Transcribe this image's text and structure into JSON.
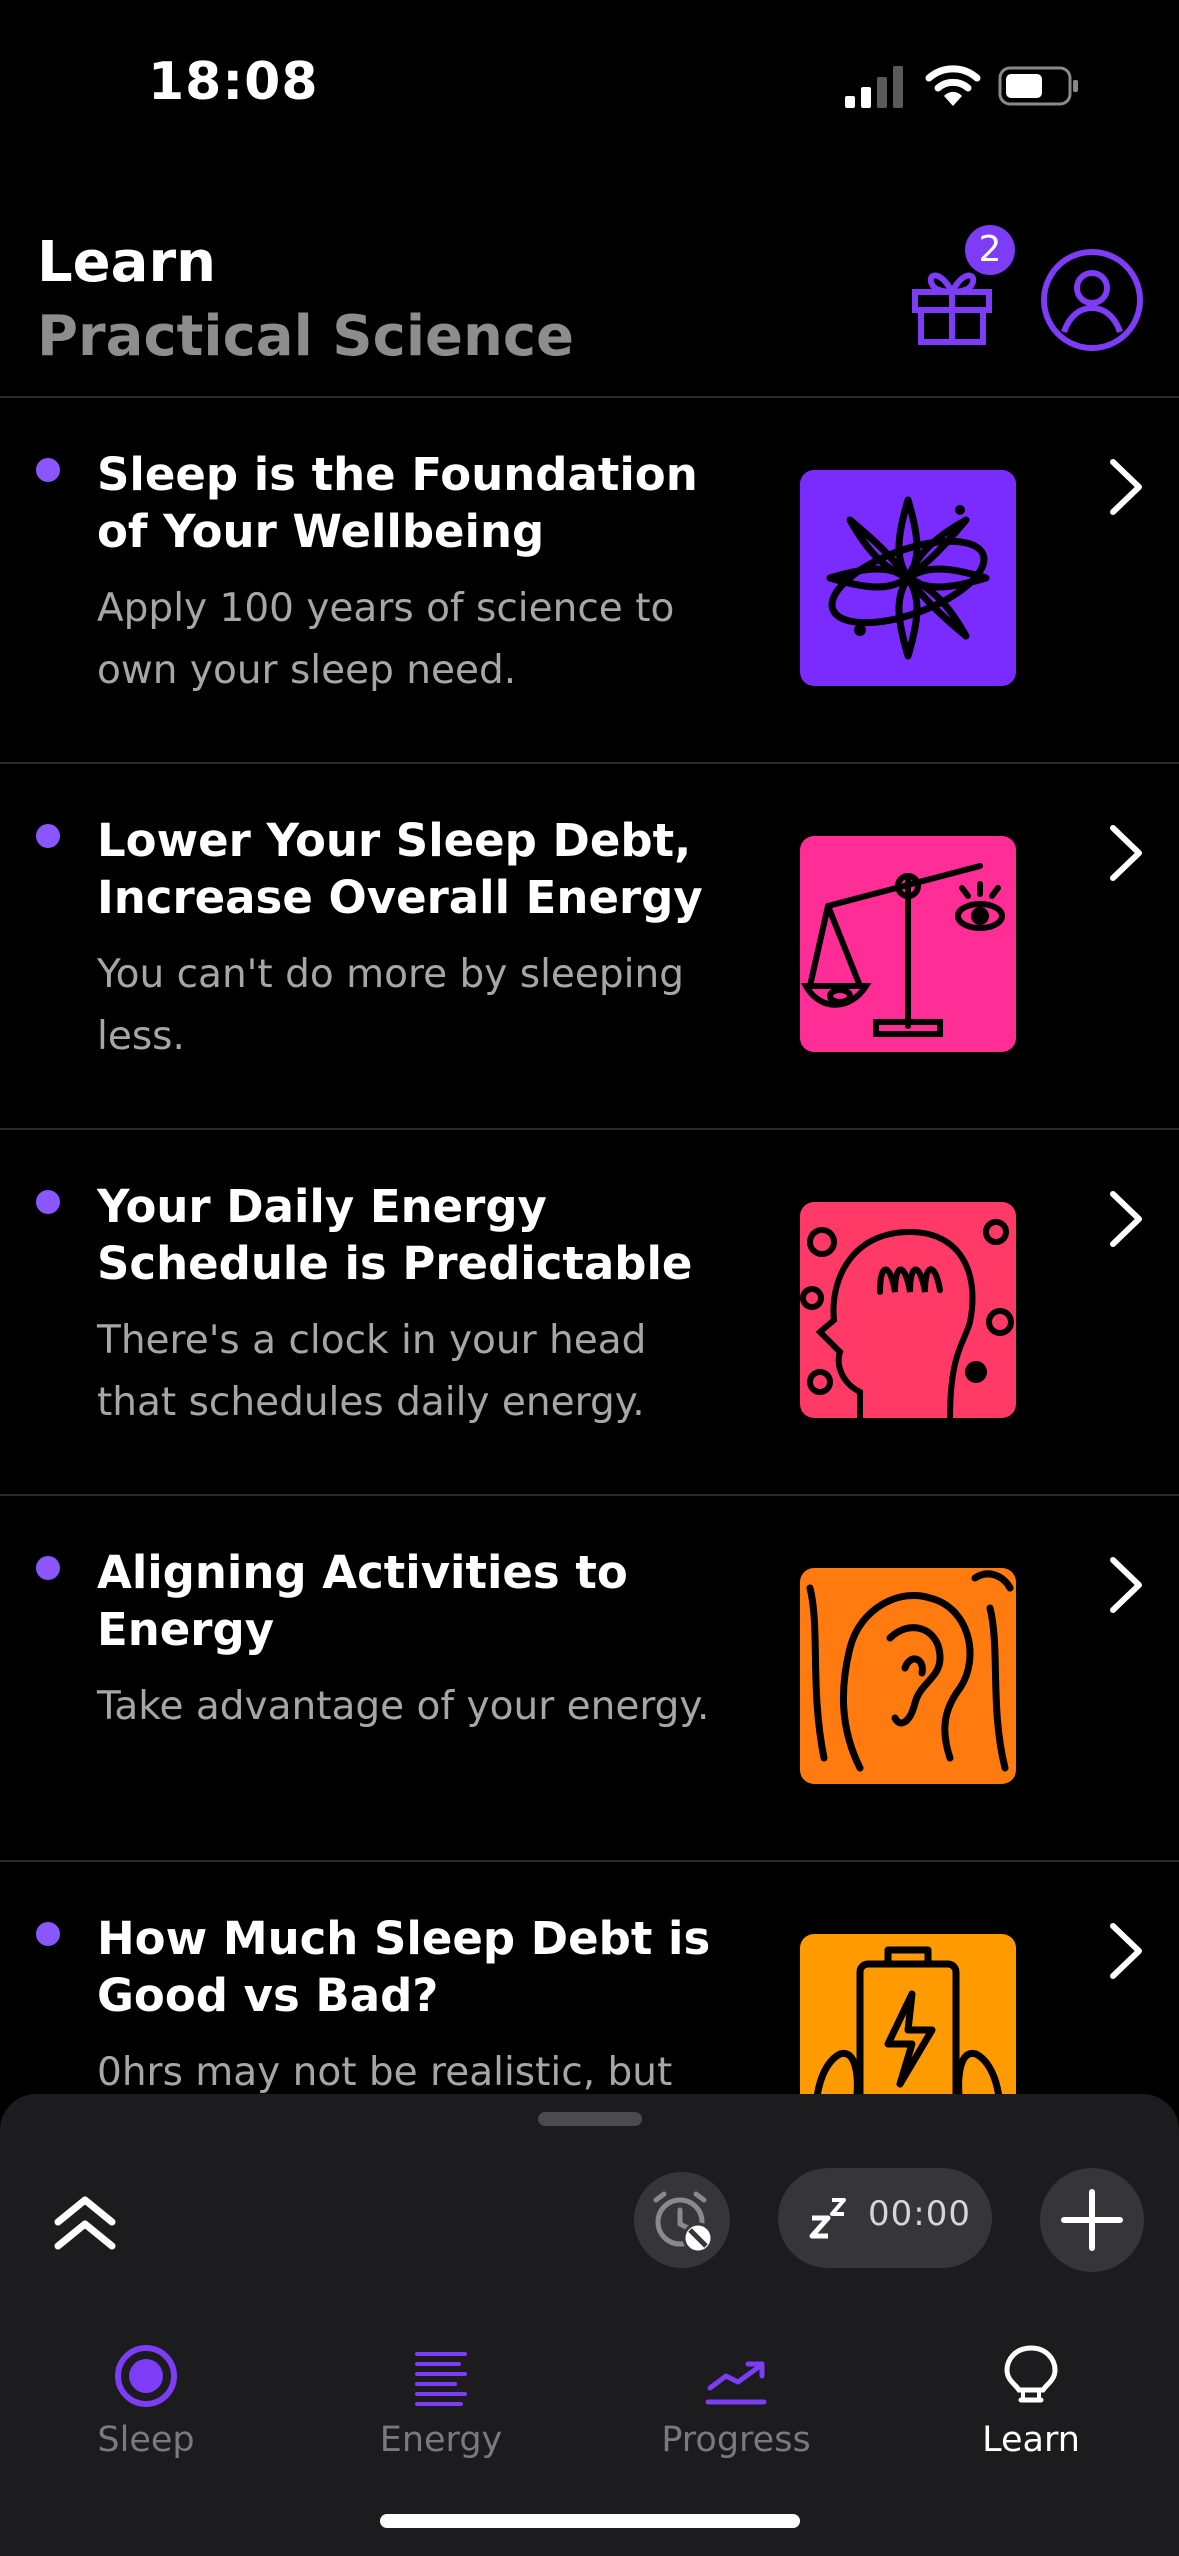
{
  "status": {
    "time": "18:08"
  },
  "header": {
    "title": "Learn",
    "subtitle": "Practical Science",
    "gift_badge": "2"
  },
  "articles": [
    {
      "title": "Sleep is the Foundation of Your Wellbeing",
      "desc": "Apply 100 years of science to own your sleep need.",
      "color": "#7a2cff",
      "icon": "sparkle-icon"
    },
    {
      "title": "Lower Your Sleep Debt, Increase Overall Energy",
      "desc": "You can't do more by sleeping less.",
      "color": "#ff2d95",
      "icon": "scale-icon"
    },
    {
      "title": "Your Daily Energy Schedule is Predictable",
      "desc": "There's a clock in your head that schedules daily energy.",
      "color": "#ff3a66",
      "icon": "head-icon"
    },
    {
      "title": "Aligning Activities to Energy",
      "desc": "Take advantage of your energy.",
      "color": "#ff7a0f",
      "icon": "ear-icon"
    },
    {
      "title": "How Much Sleep Debt is Good vs Bad?",
      "desc": "0hrs may not be realistic, but",
      "color": "#ff9a00",
      "icon": "battery-icon"
    }
  ],
  "sheet": {
    "sleep_time": "00:00"
  },
  "tabs": [
    {
      "label": "Sleep"
    },
    {
      "label": "Energy"
    },
    {
      "label": "Progress"
    },
    {
      "label": "Learn"
    }
  ],
  "colors": {
    "accent": "#7d3cf5",
    "background": "#000000",
    "sheet": "#1c1c1f"
  }
}
